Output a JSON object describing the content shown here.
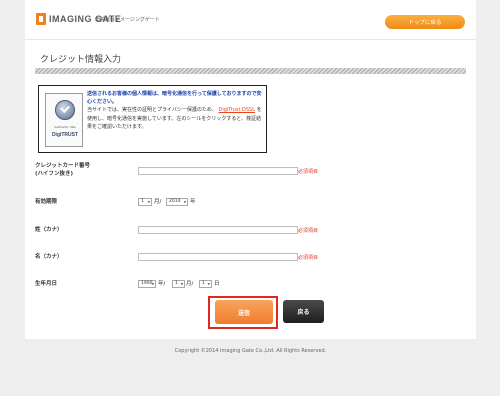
{
  "header": {
    "logo_text": "IMAGING GATE",
    "tagline": "年賀状はイメージングゲート",
    "top_button": "トップに戻る"
  },
  "page_title": "クレジット情報入力",
  "trust": {
    "seal_small": "Authentic Site",
    "seal_brand": "DigiTRUST",
    "notice": "送信されるお客様の個人情報は、暗号化通信を行って保護しておりますので安心ください。",
    "body_pre": "当サイトでは、実在性の証明とプライバシー保護のため、",
    "link": "DigiTrust DSSL",
    "body_post": "を使用し、暗号化通信を実施しています。左のシールをクリックすると、検証結果をご確認いただけます。"
  },
  "form": {
    "card_label_1": "クレジットカード番号",
    "card_label_2": "(ハイフン抜き)",
    "required": "必須項目",
    "expiry_label": "有効期限",
    "expiry_month": "1",
    "month_unit": "月/",
    "expiry_year": "2014",
    "year_unit": "年",
    "sei_label": "姓（カナ）",
    "mei_label": "名（カナ）",
    "birth_label": "生年月日",
    "birth_year": "1900",
    "birth_year_unit": "年/",
    "birth_month": "1",
    "birth_month_unit": "月/",
    "birth_day": "1",
    "birth_day_unit": "日"
  },
  "buttons": {
    "submit": "送信",
    "back": "戻る"
  },
  "footer": {
    "copyright": "Copyright ©2014 Imaging Gate Co.,Ltd. All Rights Reserved."
  }
}
